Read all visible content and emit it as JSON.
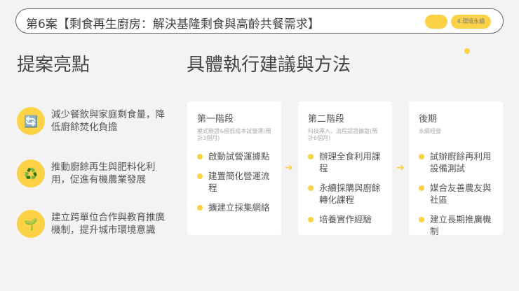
{
  "header": {
    "title": "第6案【剩食再生廚房：解決基隆剩食與高齡共餐需求】",
    "tag": "4.環境永續"
  },
  "left": {
    "heading": "提案亮點",
    "items": [
      {
        "icon": "refresh-icon",
        "glyph": "🔄",
        "text": "減少餐飲與家庭剩食量，降低廚餘焚化負擔"
      },
      {
        "icon": "recycle-icon",
        "glyph": "♻️",
        "text": "推動廚餘再生與肥料化利用，促進有機農業發展"
      },
      {
        "icon": "seedling-icon",
        "glyph": "🌱",
        "text": "建立跨單位合作與教育推廣機制，提升城市環境意識"
      }
    ]
  },
  "right": {
    "heading": "具體執行建議與方法",
    "arrow": "➜",
    "stages": [
      {
        "title": "第一階段",
        "subtitle": "模式驗證&極低成本試營運(預計3個月)",
        "items": [
          "啟動試營運據點",
          "建置簡化營運流程",
          "擴建立採集網絡"
        ]
      },
      {
        "title": "第二階段",
        "subtitle": "科技導入、流程認證擴散(預計6個月)",
        "items": [
          "辦理全食利用課程",
          "永續採購與廚餘轉化課程",
          "培養實作經驗"
        ]
      },
      {
        "title": "後期",
        "subtitle": "永續經營",
        "items": [
          "試辦廚餘再利用設備測試",
          "媒合友善農友與社區",
          "建立長期推廣機制"
        ]
      }
    ]
  },
  "colors": {
    "accent": "#fcd247"
  }
}
